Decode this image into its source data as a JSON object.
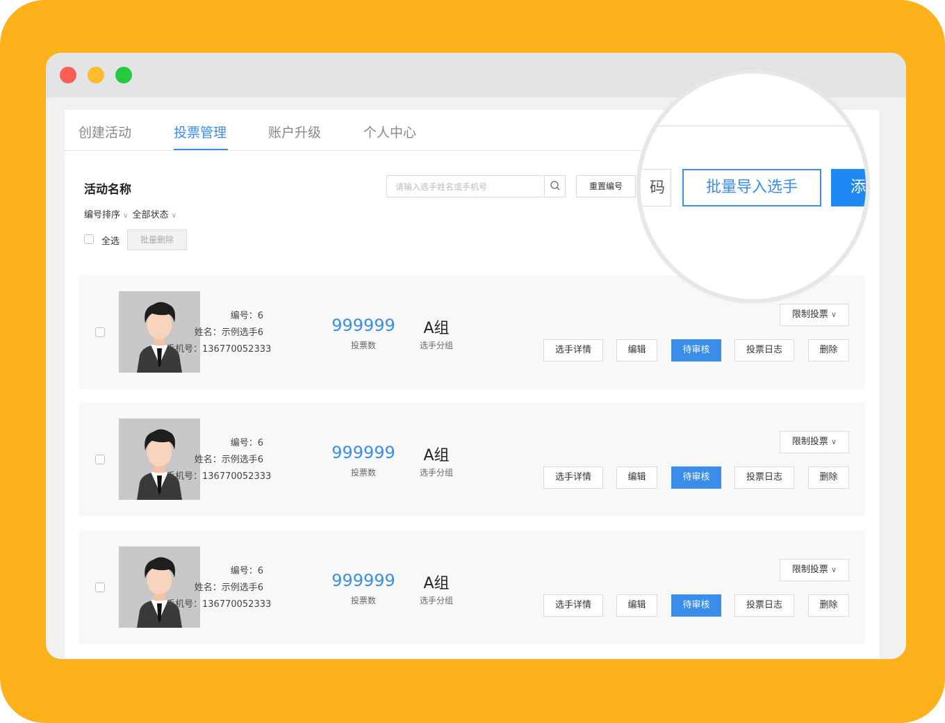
{
  "tabs": [
    {
      "label": "创建活动",
      "active": false
    },
    {
      "label": "投票管理",
      "active": true
    },
    {
      "label": "账户升级",
      "active": false
    },
    {
      "label": "个人中心",
      "active": false
    }
  ],
  "activity": {
    "title": "活动名称"
  },
  "filters": {
    "sort_label": "编号排序",
    "status_label": "全部状态"
  },
  "selection": {
    "select_all_label": "全选",
    "batch_delete_label": "批量删除"
  },
  "search": {
    "placeholder": "请输入选手姓名或手机号",
    "reset_label": "重置编号"
  },
  "magnifier": {
    "left_button_partial": "码",
    "import_label": "批量导入选手",
    "add_partial": "添"
  },
  "labels": {
    "number": "编号：",
    "name": "姓名：",
    "phone": "手机号：",
    "votes_caption": "投票数",
    "group_caption": "选手分组"
  },
  "actions": {
    "details": "选手详情",
    "edit": "编辑",
    "pending": "待审核",
    "vote_log": "投票日志",
    "delete": "删除",
    "limit_vote": "限制投票"
  },
  "players": [
    {
      "number": "6",
      "name": "示例选手6",
      "phone": "136770052333",
      "votes": "999999",
      "group": "A组"
    },
    {
      "number": "6",
      "name": "示例选手6",
      "phone": "136770052333",
      "votes": "999999",
      "group": "A组"
    },
    {
      "number": "6",
      "name": "示例选手6",
      "phone": "136770052333",
      "votes": "999999",
      "group": "A组"
    }
  ],
  "colors": {
    "accent": "#3A8EEA",
    "frame": "#FDB11A"
  }
}
